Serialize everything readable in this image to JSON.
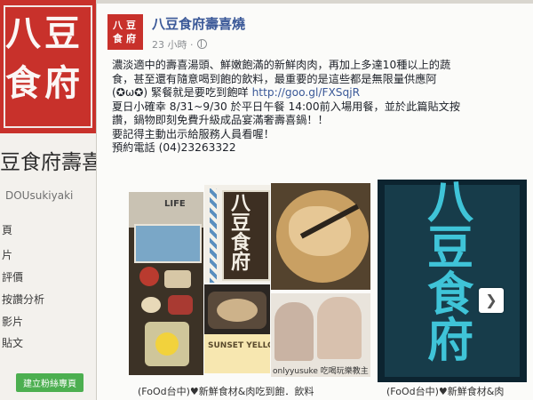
{
  "page": {
    "logo_glyphs": [
      "八",
      "豆",
      "食",
      "府"
    ],
    "name": "豆食府壽喜",
    "handle": "DOUsukiyaki",
    "nav": [
      "頁",
      "片",
      "評價",
      "按讚分析",
      "影片",
      "貼文"
    ],
    "nav_button": "建立粉絲專頁"
  },
  "post": {
    "author": "八豆食府壽喜燒",
    "time": "23 小時",
    "lines": [
      "濃淡適中的壽喜湯頭、鮮嫩飽滿的新鮮肉肉，再加上多達10種以上的蔬",
      "食，甚至還有隨意喝到飽的飲料，最重要的是這些都是無限量供應阿",
      "(✪ω✪) 緊餐就是要吃到飽咩",
      "夏日小確幸 8/31~9/30 於平日午餐 14:00前入場用餐，並於此篇貼文按",
      "讚，鍋物即刻免費升級成品宴滿奢壽喜鍋！！",
      "要記得主動出示給服務人員看喔！",
      "預約電話 (04)23263322"
    ],
    "link": "http://goo.gl/FXSqjR",
    "photo_texts": {
      "life": "LIFE",
      "sign": [
        "八",
        "豆",
        "食",
        "府"
      ],
      "sunset": "SUNSET YELLOW",
      "watermark": "onlyyusuke 吃喝玩樂教主",
      "big_sign": [
        "八",
        "豆",
        "食",
        "府"
      ]
    },
    "captions": [
      "(FoOd台中)♥新鮮食材&肉吃到飽．飲料",
      "(FoOd台中)♥新鮮食材&肉"
    ]
  },
  "colors": {
    "brand_red": "#c8312b",
    "link_blue": "#3b5998",
    "accent_cyan": "#3fc4d8"
  }
}
